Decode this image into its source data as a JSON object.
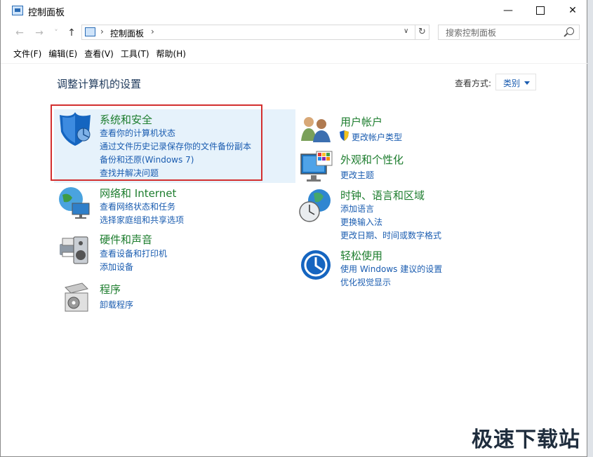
{
  "window": {
    "title": "控制面板"
  },
  "titlebar": {
    "minimize": "—",
    "close": "✕"
  },
  "nav": {
    "back": "←",
    "forward": "→",
    "recent": "˅",
    "up": "↑"
  },
  "address": {
    "path": "控制面板",
    "sep": "›",
    "dropdown": "∨",
    "refresh": "↻"
  },
  "search": {
    "placeholder": "搜索控制面板"
  },
  "menu": [
    "文件(F)",
    "编辑(E)",
    "查看(V)",
    "工具(T)",
    "帮助(H)"
  ],
  "heading": "调整计算机的设置",
  "view_by": {
    "label": "查看方式:",
    "value": "类别"
  },
  "categories": {
    "system": {
      "title": "系统和安全",
      "links": [
        "查看你的计算机状态",
        "通过文件历史记录保存你的文件备份副本",
        "备份和还原(Windows 7)",
        "查找并解决问题"
      ]
    },
    "network": {
      "title": "网络和 Internet",
      "links": [
        "查看网络状态和任务",
        "选择家庭组和共享选项"
      ]
    },
    "hardware": {
      "title": "硬件和声音",
      "links": [
        "查看设备和打印机",
        "添加设备"
      ]
    },
    "programs": {
      "title": "程序",
      "links": [
        "卸载程序"
      ]
    },
    "user": {
      "title": "用户帐户",
      "links": [
        "更改帐户类型"
      ]
    },
    "appearance": {
      "title": "外观和个性化",
      "links": [
        "更改主题"
      ]
    },
    "clock": {
      "title": "时钟、语言和区域",
      "links": [
        "添加语言",
        "更换输入法",
        "更改日期、时间或数字格式"
      ]
    },
    "ease": {
      "title": "轻松使用",
      "links": [
        "使用 Windows 建议的设置",
        "优化视觉显示"
      ]
    }
  },
  "watermark": "极速下载站",
  "colors": {
    "accent": "#1a5cb0",
    "category_title": "#1d7d2e",
    "highlight": "#d32f2f",
    "selected_bg": "#e6f2fb"
  }
}
